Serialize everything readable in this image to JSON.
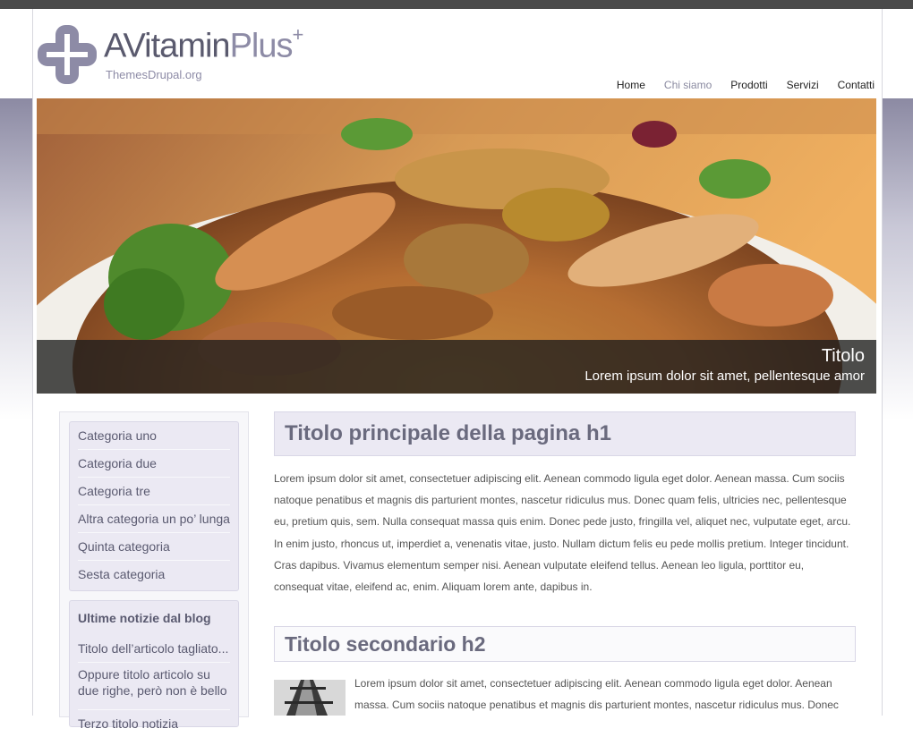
{
  "brand": {
    "name_dark": "AVitamin",
    "name_light": "Plus",
    "name_sup": "+",
    "tagline": "ThemesDrupal.org",
    "colors": {
      "accent": "#8d8ba6",
      "text": "#5a5a6e",
      "topbar": "#4a4a4a"
    }
  },
  "nav": {
    "items": [
      {
        "label": "Home",
        "active": false
      },
      {
        "label": "Chi siamo",
        "active": true
      },
      {
        "label": "Prodotti",
        "active": false
      },
      {
        "label": "Servizi",
        "active": false
      },
      {
        "label": "Contatti",
        "active": false
      }
    ]
  },
  "hero": {
    "caption_title": "Titolo",
    "caption_text": "Lorem ipsum dolor sit amet, pellentesque amor"
  },
  "sidebar": {
    "categories": [
      {
        "label": "Categoria uno"
      },
      {
        "label": "Categoria due"
      },
      {
        "label": "Categoria tre"
      },
      {
        "label": "Altra categoria un po’ lunga"
      },
      {
        "label": "Quinta categoria"
      },
      {
        "label": "Sesta categoria"
      }
    ],
    "blog": {
      "title": "Ultime notizie dal blog",
      "items": [
        {
          "label": "Titolo dell’articolo tagliato..."
        },
        {
          "label": "Oppure titolo articolo su due righe, però non è bello"
        },
        {
          "label": "Terzo titolo notizia"
        }
      ]
    }
  },
  "main": {
    "h1": "Titolo principale della pagina h1",
    "paragraph1": "Lorem ipsum dolor sit amet, consectetuer adipiscing elit. Aenean commodo ligula eget dolor. Aenean massa. Cum sociis natoque penatibus et magnis dis parturient montes, nascetur ridiculus mus. Donec quam felis, ultricies nec, pellentesque eu, pretium quis, sem. Nulla consequat massa quis enim. Donec pede justo, fringilla vel, aliquet nec, vulputate eget, arcu. In enim justo, rhoncus ut, imperdiet a, venenatis vitae, justo. Nullam dictum felis eu pede mollis pretium. Integer tincidunt. Cras dapibus. Vivamus elementum semper nisi. Aenean vulputate eleifend tellus. Aenean leo ligula, porttitor eu, consequat vitae, eleifend ac, enim. Aliquam lorem ante, dapibus in.",
    "h2": "Titolo secondario h2",
    "paragraph2": "Lorem ipsum dolor sit amet, consectetuer adipiscing elit. Aenean commodo ligula eget dolor. Aenean massa. Cum sociis natoque penatibus et magnis dis parturient montes, nascetur ridiculus mus. Donec"
  }
}
